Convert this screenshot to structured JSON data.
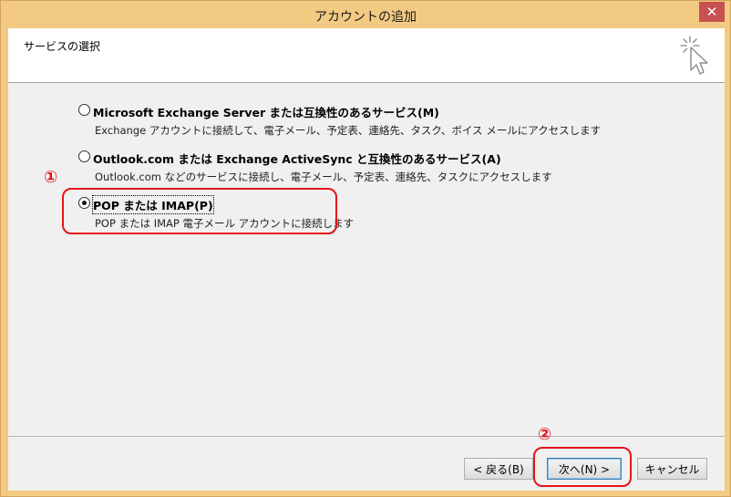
{
  "window": {
    "title": "アカウントの追加",
    "close_glyph": "✕"
  },
  "header": {
    "title": "サービスの選択",
    "icon": "wizard-cursor-icon"
  },
  "options": [
    {
      "label": "Microsoft Exchange Server または互換性のあるサービス(M)",
      "description": "Exchange アカウントに接続して、電子メール、予定表、連絡先、タスク、ボイス メールにアクセスします",
      "checked": false
    },
    {
      "label": "Outlook.com または Exchange ActiveSync と互換性のあるサービス(A)",
      "description": "Outlook.com などのサービスに接続し、電子メール、予定表、連絡先、タスクにアクセスします",
      "checked": false
    },
    {
      "label": "POP または IMAP(P)",
      "description": "POP または IMAP 電子メール アカウントに接続します",
      "checked": true
    }
  ],
  "buttons": {
    "back": "< 戻る(B)",
    "next": "次へ(N) >",
    "cancel": "キャンセル"
  },
  "annotations": {
    "one": "①",
    "two": "②",
    "color": "#e5141a"
  }
}
